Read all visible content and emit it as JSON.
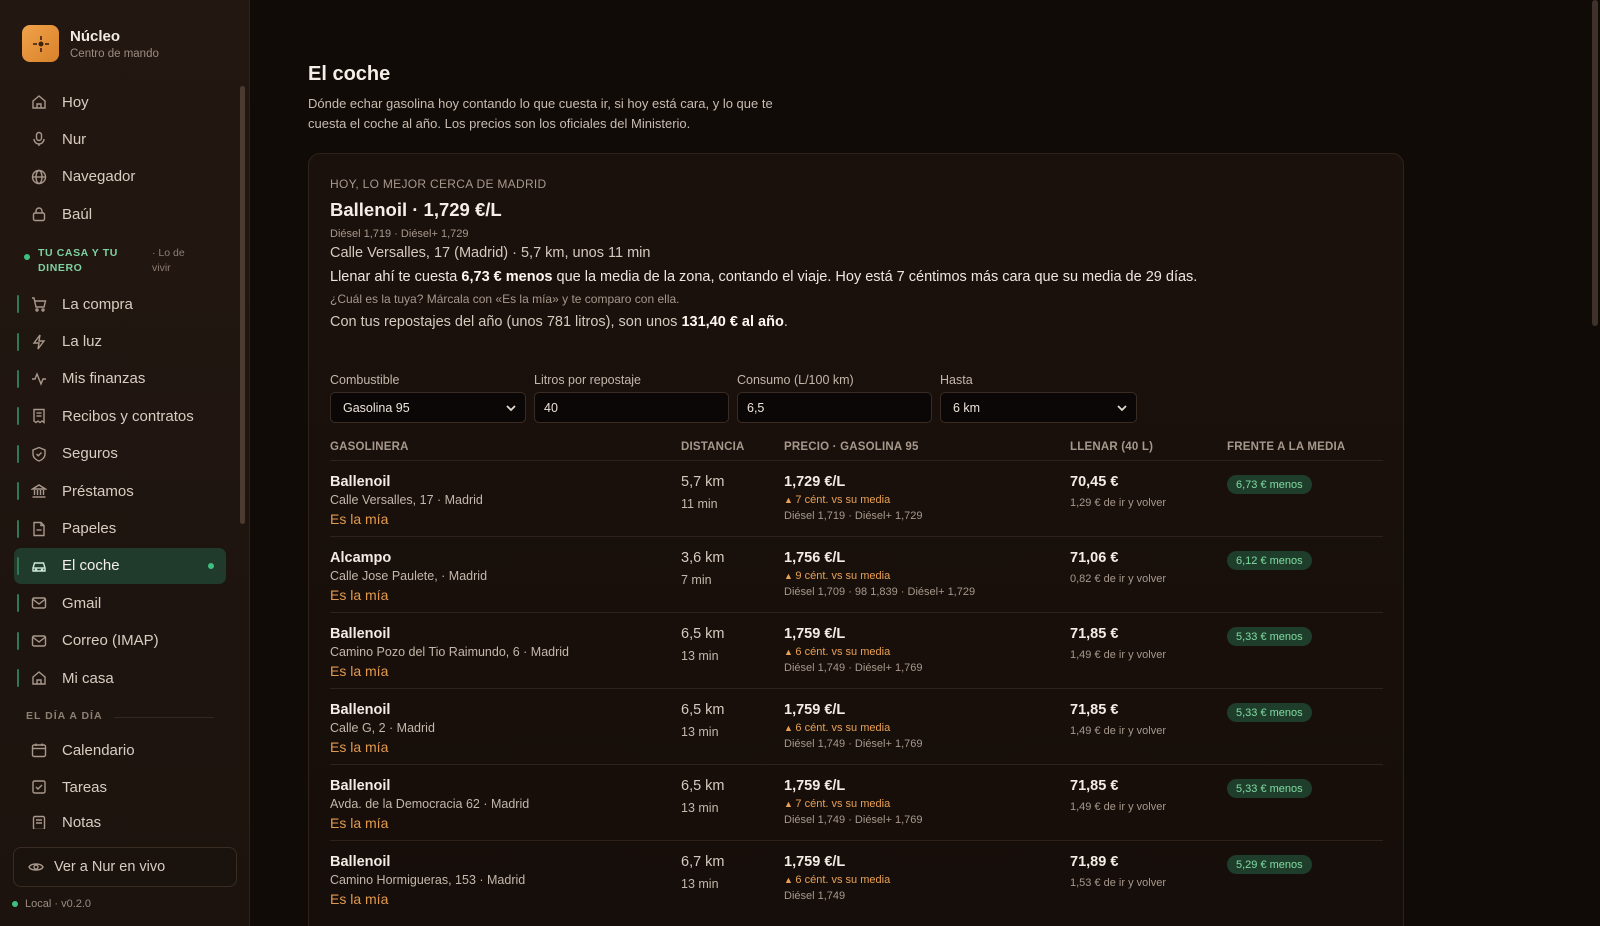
{
  "app": {
    "name": "Núcleo",
    "subtitle": "Centro de mando"
  },
  "sidebar": {
    "top_items": [
      {
        "label": "Hoy",
        "icon": "home-icon"
      },
      {
        "label": "Nur",
        "icon": "microphone-icon"
      },
      {
        "label": "Navegador",
        "icon": "globe-icon"
      },
      {
        "label": "Baúl",
        "icon": "lock-icon"
      }
    ],
    "section_home": {
      "title": "TU CASA Y TU DINERO",
      "note": "· Lo de vivir"
    },
    "home_items": [
      {
        "label": "La compra",
        "icon": "cart-icon"
      },
      {
        "label": "La luz",
        "icon": "bolt-icon"
      },
      {
        "label": "Mis finanzas",
        "icon": "activity-icon"
      },
      {
        "label": "Recibos y contratos",
        "icon": "receipt-icon"
      },
      {
        "label": "Seguros",
        "icon": "shield-icon"
      },
      {
        "label": "Préstamos",
        "icon": "bank-icon"
      },
      {
        "label": "Papeles",
        "icon": "document-icon"
      },
      {
        "label": "El coche",
        "icon": "car-icon"
      },
      {
        "label": "Gmail",
        "icon": "mail-icon"
      },
      {
        "label": "Correo (IMAP)",
        "icon": "mail-icon"
      },
      {
        "label": "Mi casa",
        "icon": "house-icon"
      }
    ],
    "section_day": "EL DÍA A DÍA",
    "day_items": [
      {
        "label": "Calendario",
        "icon": "calendar-icon"
      },
      {
        "label": "Tareas",
        "icon": "checkbox-icon"
      },
      {
        "label": "Notas",
        "icon": "notes-icon"
      }
    ],
    "live_button": "Ver a Nur en vivo",
    "version": "Local · v0.2.0"
  },
  "page": {
    "title": "El coche",
    "description": "Dónde echar gasolina hoy contando lo que cuesta ir, si hoy está cara, y lo que te cuesta el coche al año. Los precios son los oficiales del Ministerio."
  },
  "hero": {
    "eyebrow": "HOY, LO MEJOR CERCA DE MADRID",
    "title": "Ballenoil · 1,729 €/L",
    "sub": "Diésel 1,719 · Diésel+ 1,729",
    "address": "Calle Versalles, 17 (Madrid) · 5,7 km, unos 11 min",
    "line_pre": "Llenar ahí te cuesta ",
    "line_bold": "6,73 € menos",
    "line_post": " que la media de la zona, contando el viaje. Hoy está 7 céntimos más cara que su media de 29 días.",
    "hint": "¿Cuál es la tuya? Márcala con «Es la mía» y te comparo con ella.",
    "year_pre": "Con tus repostajes del año (unos 781 litros), son unos ",
    "year_bold": "131,40 € al año",
    "year_post": "."
  },
  "form": {
    "fuel_label": "Combustible",
    "fuel_value": "Gasolina 95",
    "liters_label": "Litros por repostaje",
    "liters_value": "40",
    "consumption_label": "Consumo (L/100 km)",
    "consumption_value": "6,5",
    "range_label": "Hasta",
    "range_value": "6 km"
  },
  "table": {
    "headers": [
      "GASOLINERA",
      "DISTANCIA",
      "PRECIO · GASOLINA 95",
      "LLENAR (40 L)",
      "FRENTE A LA MEDIA"
    ],
    "mine_label": "Es la mía",
    "rows": [
      {
        "name": "Ballenoil",
        "address": "Calle Versalles, 17 · Madrid",
        "distance": "5,7 km",
        "time": "11 min",
        "price": "1,729 €/L",
        "warning": "7 cént. vs su media",
        "other": "Diésel 1,719 · Diésel+ 1,729",
        "fill": "70,45 €",
        "trip": "1,29 € de ir y volver",
        "badge": "6,73 € menos"
      },
      {
        "name": "Alcampo",
        "address": "Calle Jose Paulete, · Madrid",
        "distance": "3,6 km",
        "time": "7 min",
        "price": "1,756 €/L",
        "warning": "9 cént. vs su media",
        "other": "Diésel 1,709 · 98 1,839 · Diésel+ 1,729",
        "fill": "71,06 €",
        "trip": "0,82 € de ir y volver",
        "badge": "6,12 € menos"
      },
      {
        "name": "Ballenoil",
        "address": "Camino Pozo del Tio Raimundo, 6 · Madrid",
        "distance": "6,5 km",
        "time": "13 min",
        "price": "1,759 €/L",
        "warning": "6 cént. vs su media",
        "other": "Diésel 1,749 · Diésel+ 1,769",
        "fill": "71,85 €",
        "trip": "1,49 € de ir y volver",
        "badge": "5,33 € menos"
      },
      {
        "name": "Ballenoil",
        "address": "Calle G, 2 · Madrid",
        "distance": "6,5 km",
        "time": "13 min",
        "price": "1,759 €/L",
        "warning": "6 cént. vs su media",
        "other": "Diésel 1,749 · Diésel+ 1,769",
        "fill": "71,85 €",
        "trip": "1,49 € de ir y volver",
        "badge": "5,33 € menos"
      },
      {
        "name": "Ballenoil",
        "address": "Avda. de la Democracia 62 · Madrid",
        "distance": "6,5 km",
        "time": "13 min",
        "price": "1,759 €/L",
        "warning": "7 cént. vs su media",
        "other": "Diésel 1,749 · Diésel+ 1,769",
        "fill": "71,85 €",
        "trip": "1,49 € de ir y volver",
        "badge": "5,33 € menos"
      },
      {
        "name": "Ballenoil",
        "address": "Camino Hormigueras, 153 · Madrid",
        "distance": "6,7 km",
        "time": "13 min",
        "price": "1,759 €/L",
        "warning": "6 cént. vs su media",
        "other": "Diésel 1,749",
        "fill": "71,89 €",
        "trip": "1,53 € de ir y volver",
        "badge": "5,29 € menos"
      }
    ]
  },
  "colors": {
    "accent_green": "#3fbf7f",
    "accent_orange": "#e39a4f",
    "badge_bg": "#1f3d2b"
  }
}
